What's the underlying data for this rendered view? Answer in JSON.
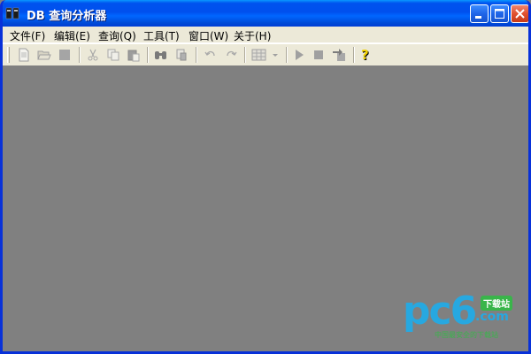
{
  "window": {
    "title": "DB 查询分析器"
  },
  "menu": {
    "items": [
      {
        "label": "文件(F)"
      },
      {
        "label": "编辑(E)"
      },
      {
        "label": "查询(Q)"
      },
      {
        "label": "工具(T)"
      },
      {
        "label": "窗口(W)"
      },
      {
        "label": "关于(H)"
      }
    ]
  },
  "toolbar": {
    "buttons": [
      {
        "icon": "new-query-icon",
        "enabled": false
      },
      {
        "icon": "open-folder-icon",
        "enabled": false
      },
      {
        "icon": "save-icon",
        "enabled": false
      },
      {
        "icon": "cut-icon",
        "enabled": false
      },
      {
        "icon": "copy-icon",
        "enabled": false
      },
      {
        "icon": "paste-icon",
        "enabled": false
      },
      {
        "icon": "find-icon",
        "enabled": false
      },
      {
        "icon": "replace-icon",
        "enabled": false
      },
      {
        "icon": "undo-icon",
        "enabled": false
      },
      {
        "icon": "redo-icon",
        "enabled": false
      },
      {
        "icon": "results-grid-icon",
        "enabled": false
      },
      {
        "icon": "execute-icon",
        "enabled": false
      },
      {
        "icon": "stop-icon",
        "enabled": false
      },
      {
        "icon": "export-icon",
        "enabled": false
      },
      {
        "icon": "help-icon",
        "enabled": true
      }
    ]
  },
  "watermark": {
    "brand": "pc6",
    "domain": ".com",
    "badge": "下载站",
    "slogan": "中国最安全的下载站"
  },
  "colors": {
    "titlebar": "#0054e3",
    "menubar": "#ece9d8",
    "client": "#808080",
    "watermark_blue": "#27a8e0",
    "watermark_green": "#39b54a"
  }
}
